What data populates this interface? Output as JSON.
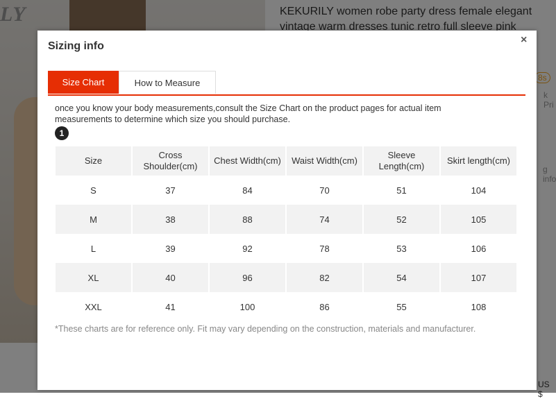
{
  "background": {
    "brand_text": "LY",
    "product_title": "KEKURILY women robe party dress female elegant vintage warm dresses tunic retro full sleeve pink clothing",
    "badge_text": "8s",
    "side_text_1": "k Pri",
    "side_text_2": "g info",
    "price_fragment": "US $"
  },
  "modal": {
    "title": "Sizing info",
    "close_symbol": "×",
    "tabs": [
      {
        "label": "Size Chart",
        "active": true
      },
      {
        "label": "How to Measure",
        "active": false
      }
    ],
    "intro": "once you know your body measurements,consult the Size Chart on the product pages for actual item measurements to determine which size you should purchase.",
    "step_number": "1",
    "table": {
      "headers": [
        "Size",
        "Cross Shoulder(cm)",
        "Chest Width(cm)",
        "Waist Width(cm)",
        "Sleeve Length(cm)",
        "Skirt length(cm)"
      ],
      "rows": [
        [
          "S",
          "37",
          "84",
          "70",
          "51",
          "104"
        ],
        [
          "M",
          "38",
          "88",
          "74",
          "52",
          "105"
        ],
        [
          "L",
          "39",
          "92",
          "78",
          "53",
          "106"
        ],
        [
          "XL",
          "40",
          "96",
          "82",
          "54",
          "107"
        ],
        [
          "XXL",
          "41",
          "100",
          "86",
          "55",
          "108"
        ]
      ]
    },
    "footnote": "*These charts are for reference only. Fit may vary depending on the construction, materials and manufacturer."
  },
  "colors": {
    "accent": "#e62e04",
    "overlay": "rgba(0,0,0,0.5)",
    "row_alt": "#f2f2f2"
  }
}
